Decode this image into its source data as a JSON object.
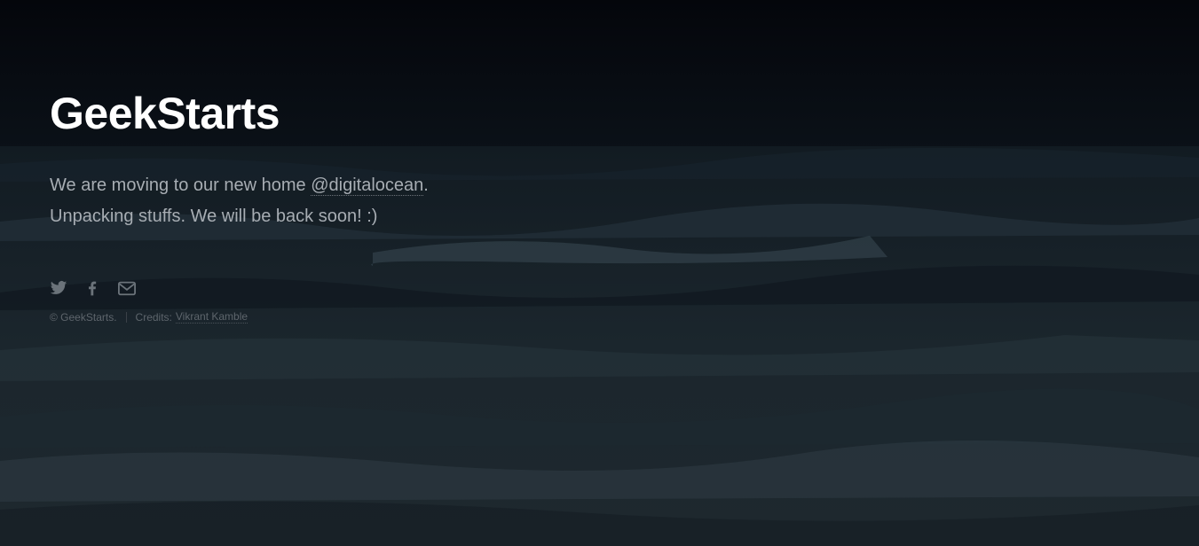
{
  "site": {
    "title": "GeekStarts",
    "tagline_line1_prefix": "We are moving to our new home ",
    "tagline_link": "@digitalocean",
    "tagline_line1_suffix": ".",
    "tagline_line2": "Unpacking stuffs. We will be back soon! :)"
  },
  "social": {
    "icons": [
      "twitter-icon",
      "facebook-icon",
      "email-icon"
    ],
    "icon_color": "#6b737a"
  },
  "footer": {
    "copyright": "© GeekStarts.",
    "credits_label": "Credits:",
    "credits_link": "Vikrant Kamble"
  },
  "colors": {
    "title": "#ffffff",
    "text": "#a7adb3",
    "muted": "#5e656c",
    "background": "#0b0f14"
  }
}
